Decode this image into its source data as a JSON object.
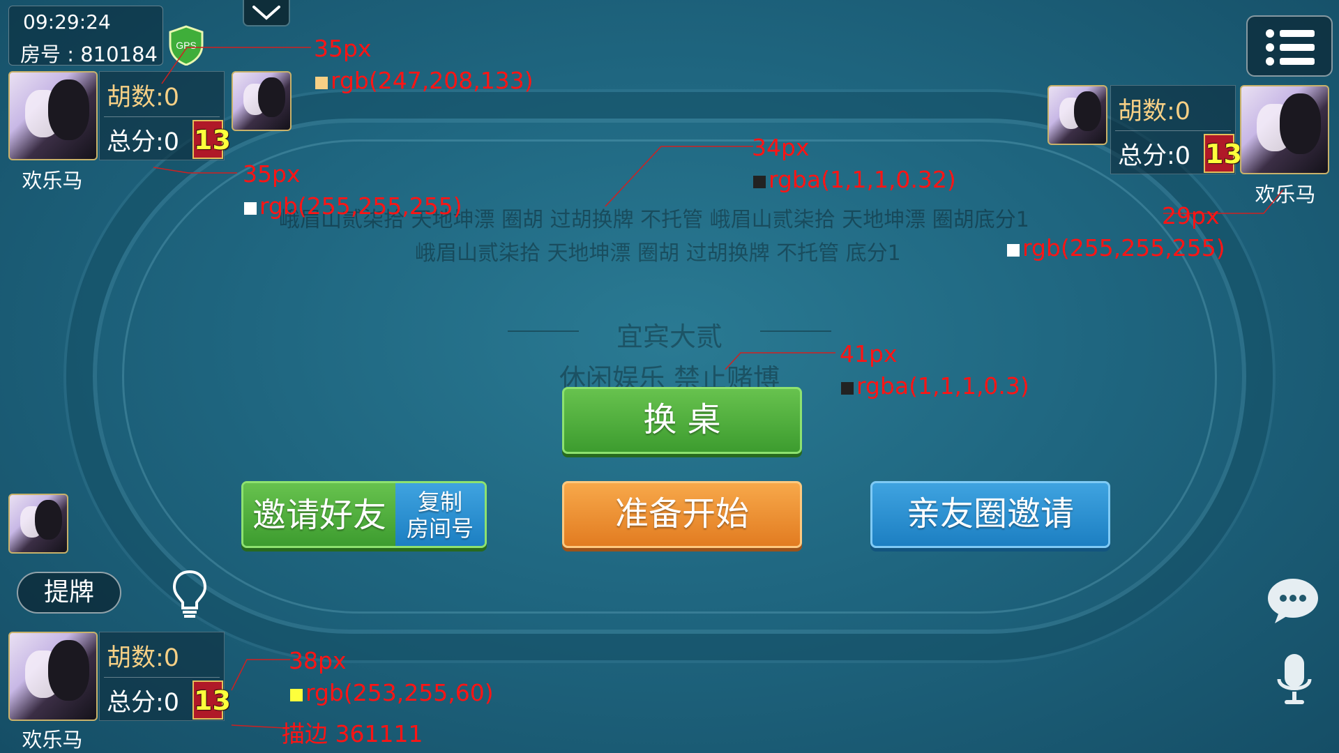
{
  "status": {
    "time": "09:29:24",
    "room": "房号 : 810184",
    "gps_label": "GPS"
  },
  "players": [
    {
      "name": "欢乐马",
      "hu": "胡数:0",
      "total": "总分:0",
      "badge": "13"
    },
    {
      "name": "欢乐马",
      "hu": "胡数:0",
      "total": "总分:0",
      "badge": "13"
    },
    {
      "name": "欢乐马",
      "hu": "胡数:0",
      "total": "总分:0",
      "badge": "13"
    }
  ],
  "rules": {
    "line1": "峨眉山贰柒拾 天地坤漂 圈胡 过胡换牌 不托管 峨眉山贰柒拾 天地坤漂 圈胡底分1",
    "line2": "峨眉山贰柒拾 天地坤漂 圈胡 过胡换牌 不托管 底分1"
  },
  "center": {
    "title": "宜宾大贰",
    "subtitle": "休闲娱乐 禁止赌博"
  },
  "buttons": {
    "change_table": "换 桌",
    "ready": "准备开始",
    "invite_friend": "邀请好友",
    "copy_room_line1": "复制",
    "copy_room_line2": "房间号",
    "circle_invite": "亲友圈邀请",
    "tipai": "提牌"
  },
  "annotations": [
    {
      "size": "35px",
      "color_label": "rgb(247,208,133)",
      "swatch": "#f7d085"
    },
    {
      "size": "35px",
      "color_label": "rgb(255,255,255)",
      "swatch": "#ffffff"
    },
    {
      "size": "34px",
      "color_label": "rgba(1,1,1,0.32)",
      "swatch": "#222222"
    },
    {
      "size": "29px",
      "color_label": "rgb(255,255,255)",
      "swatch": "#ffffff"
    },
    {
      "size": "41px",
      "color_label": "rgba(1,1,1,0.3)",
      "swatch": "#222222"
    },
    {
      "size": "38px",
      "color_label": "rgb(253,255,60)",
      "swatch": "#fdff3c",
      "stroke": "描边 361111"
    }
  ]
}
